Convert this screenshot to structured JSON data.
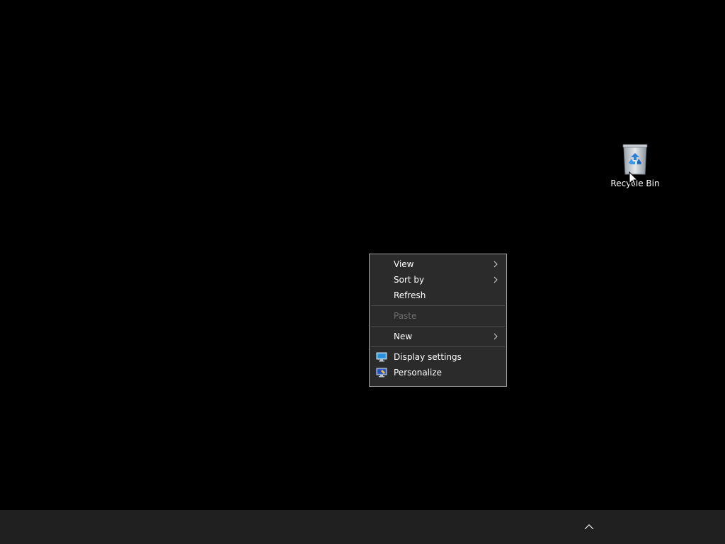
{
  "desktop": {
    "icons": [
      {
        "label": "Recycle Bin",
        "icon": "recycle-bin-icon"
      }
    ]
  },
  "context_menu": {
    "items": [
      {
        "label": "View",
        "has_submenu": true,
        "enabled": true
      },
      {
        "label": "Sort by",
        "has_submenu": true,
        "enabled": true
      },
      {
        "label": "Refresh",
        "has_submenu": false,
        "enabled": true
      },
      {
        "label": "Paste",
        "has_submenu": false,
        "enabled": false
      },
      {
        "label": "New",
        "has_submenu": true,
        "enabled": true
      },
      {
        "label": "Display settings",
        "has_submenu": false,
        "enabled": true,
        "icon": "display-settings-icon"
      },
      {
        "label": "Personalize",
        "has_submenu": false,
        "enabled": true,
        "icon": "personalize-icon"
      }
    ]
  },
  "taskbar": {
    "tray_icon": "chevron-up-icon"
  },
  "colors": {
    "desktop_bg": "#000000",
    "menu_bg": "#2b2b2b",
    "menu_border": "#a0a0a0",
    "taskbar_bg": "#202020",
    "disabled_text": "#6d6d6d"
  }
}
